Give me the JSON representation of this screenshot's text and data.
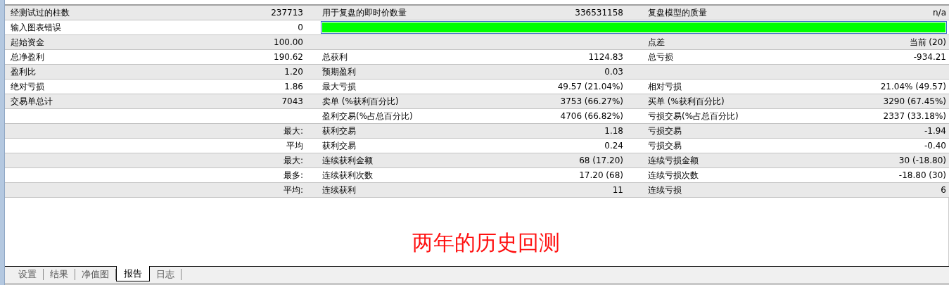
{
  "report": {
    "rows": [
      {
        "cells": [
          {
            "kind": "pair",
            "label": "经测试过的柱数",
            "value": "237713"
          },
          {
            "kind": "pair",
            "label": "用于复盘的即时价数量",
            "value": "336531158"
          },
          {
            "kind": "pair",
            "label": "复盘模型的质量",
            "value": "n/a"
          }
        ]
      },
      {
        "cells": [
          {
            "kind": "pair",
            "label": "输入图表错误",
            "value": "0"
          },
          {
            "kind": "bar",
            "level": 1
          }
        ]
      },
      {
        "cells": [
          {
            "kind": "pair",
            "label": "起始资金",
            "value": "100.00"
          },
          {
            "kind": "blank"
          },
          {
            "kind": "pair",
            "label": "点差",
            "value": "当前 (20)"
          }
        ]
      },
      {
        "cells": [
          {
            "kind": "pair",
            "label": "总净盈利",
            "value": "190.62"
          },
          {
            "kind": "pair",
            "label": "总获利",
            "value": "1124.83"
          },
          {
            "kind": "pair",
            "label": "总亏损",
            "value": "-934.21"
          }
        ]
      },
      {
        "cells": [
          {
            "kind": "pair",
            "label": "盈利比",
            "value": "1.20"
          },
          {
            "kind": "pair",
            "label": "预期盈利",
            "value": "0.03"
          },
          {
            "kind": "blank"
          }
        ]
      },
      {
        "cells": [
          {
            "kind": "pair",
            "label": "绝对亏损",
            "value": "1.86"
          },
          {
            "kind": "pair",
            "label": "最大亏损",
            "value": "49.57 (21.04%)"
          },
          {
            "kind": "pair",
            "label": "相对亏损",
            "value": "21.04% (49.57)"
          }
        ]
      },
      {
        "cells": [
          {
            "kind": "pair",
            "label": "交易单总计",
            "value": "7043"
          },
          {
            "kind": "pair",
            "label": "卖单 (%获利百分比)",
            "value": "3753 (66.27%)"
          },
          {
            "kind": "pair",
            "label": "买单 (%获利百分比)",
            "value": "3290 (67.45%)"
          }
        ]
      },
      {
        "cells": [
          {
            "kind": "blank"
          },
          {
            "kind": "pair",
            "label": "盈利交易(%占总百分比)",
            "value": "4706 (66.82%)"
          },
          {
            "kind": "pair",
            "label": "亏损交易(%占总百分比)",
            "value": "2337 (33.18%)"
          }
        ]
      },
      {
        "cells": [
          {
            "kind": "pair",
            "value": "最大:"
          },
          {
            "kind": "pair",
            "label": "获利交易",
            "value": "1.18"
          },
          {
            "kind": "pair",
            "label": "亏损交易",
            "value": "-1.94"
          }
        ]
      },
      {
        "cells": [
          {
            "kind": "pair",
            "value": "平均"
          },
          {
            "kind": "pair",
            "label": "获利交易",
            "value": "0.24"
          },
          {
            "kind": "pair",
            "label": "亏损交易",
            "value": "-0.40"
          }
        ]
      },
      {
        "cells": [
          {
            "kind": "pair",
            "value": "最大:"
          },
          {
            "kind": "pair",
            "label": "连续获利金额",
            "value": "68 (17.20)"
          },
          {
            "kind": "pair",
            "label": "连续亏损金额",
            "value": "30 (-18.80)"
          }
        ]
      },
      {
        "cells": [
          {
            "kind": "pair",
            "value": "最多:"
          },
          {
            "kind": "pair",
            "label": "连续获利次数",
            "value": "17.20 (68)"
          },
          {
            "kind": "pair",
            "label": "连续亏损次数",
            "value": "-18.80 (30)"
          }
        ]
      },
      {
        "cells": [
          {
            "kind": "pair",
            "value": "平均:"
          },
          {
            "kind": "pair",
            "label": "连续获利",
            "value": "11"
          },
          {
            "kind": "pair",
            "label": "连续亏损",
            "value": "6"
          }
        ]
      }
    ]
  },
  "caption": "两年的历史回测",
  "tabs": [
    {
      "label": "设置",
      "selected": false
    },
    {
      "label": "结果",
      "selected": false
    },
    {
      "label": "净值图",
      "selected": false
    },
    {
      "label": "报告",
      "selected": true
    },
    {
      "label": "日志",
      "selected": false
    }
  ]
}
